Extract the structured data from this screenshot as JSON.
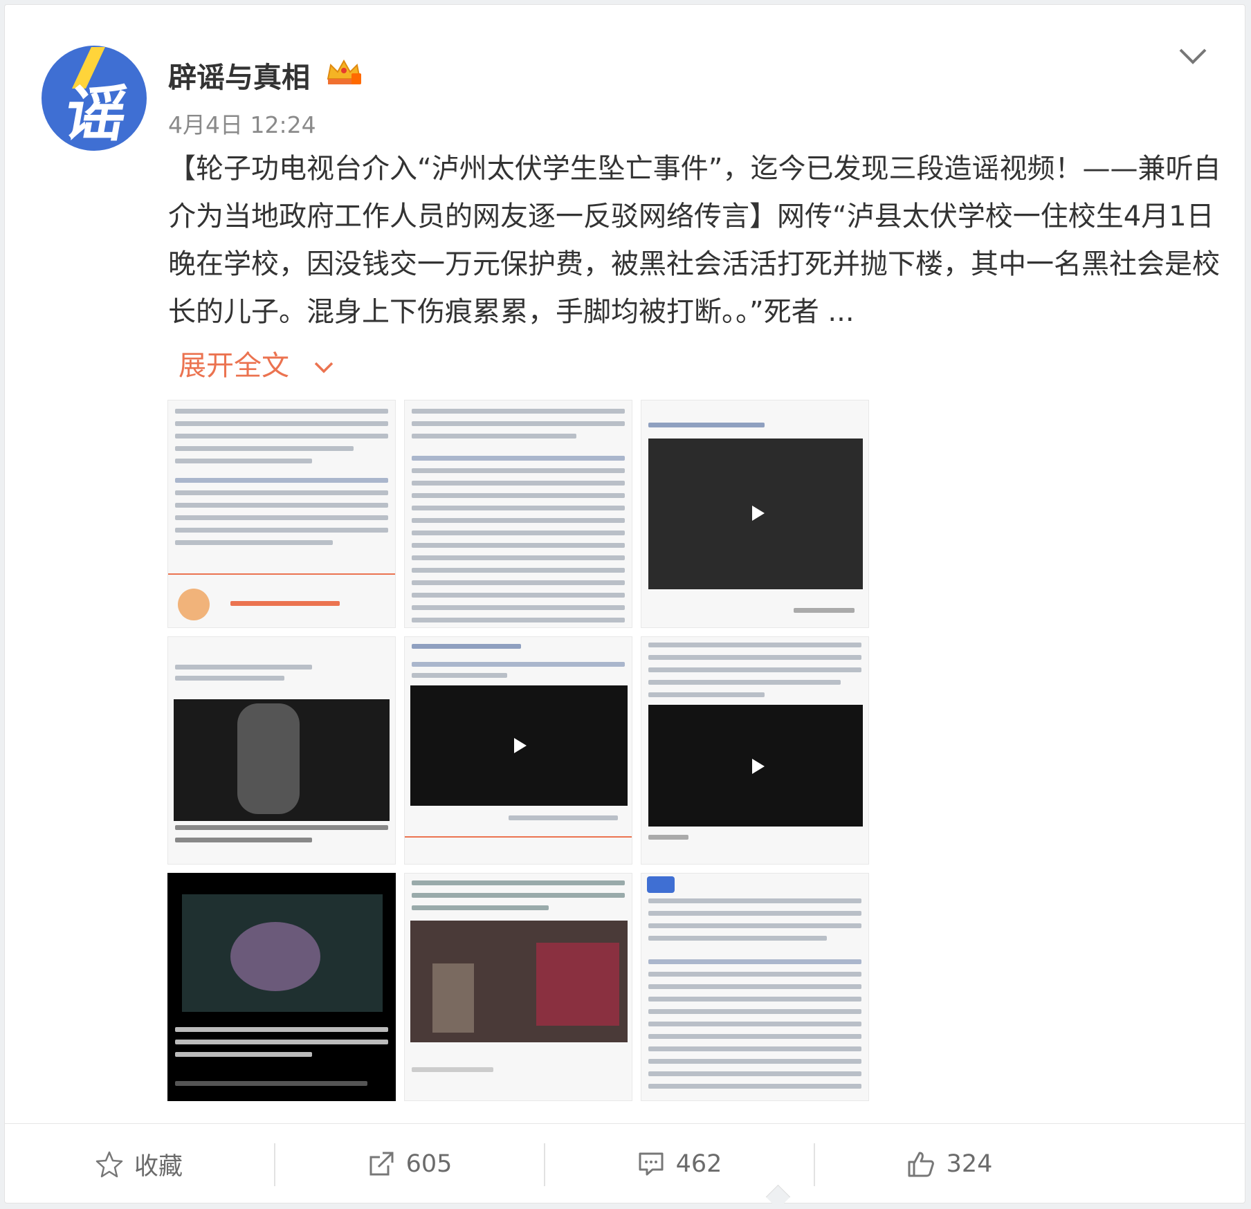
{
  "post": {
    "username": "辟谣与真相",
    "avatar_text": "谣",
    "timestamp": "4月4日 12:24",
    "content": "【轮子功电视台介入“泸州太伏学生坠亡事件”，迄今已发现三段造谣视频！——兼听自介为当地政府工作人员的网友逐一反驳网络传言】网传“泸县太伏学校一住校生4月1日晚在学校，因没钱交一万元保护费，被黑社会活活打死并抛下楼，其中一名黑社会是校长的儿子。混身上下伤痕累累，手脚均被打断。。”死者 ...",
    "expand_label": "展开全文"
  },
  "images": [
    {
      "name": "image-1",
      "type": "text"
    },
    {
      "name": "image-2",
      "type": "text"
    },
    {
      "name": "image-3",
      "type": "video"
    },
    {
      "name": "image-4",
      "type": "photo"
    },
    {
      "name": "image-5",
      "type": "video"
    },
    {
      "name": "image-6",
      "type": "video"
    },
    {
      "name": "image-7",
      "type": "photo"
    },
    {
      "name": "image-8",
      "type": "photo"
    },
    {
      "name": "image-9",
      "type": "text"
    }
  ],
  "actions": {
    "favorite_label": "收藏",
    "repost_count": "605",
    "comment_count": "462",
    "like_count": "324"
  },
  "colors": {
    "link": "#eb7350",
    "avatar_bg": "#3f6fd3",
    "text": "#333333",
    "muted": "#8a8a8a"
  },
  "icons": [
    "chevron-down-icon",
    "crown-icon",
    "star-icon",
    "repost-icon",
    "comment-icon",
    "like-icon",
    "play-icon"
  ]
}
